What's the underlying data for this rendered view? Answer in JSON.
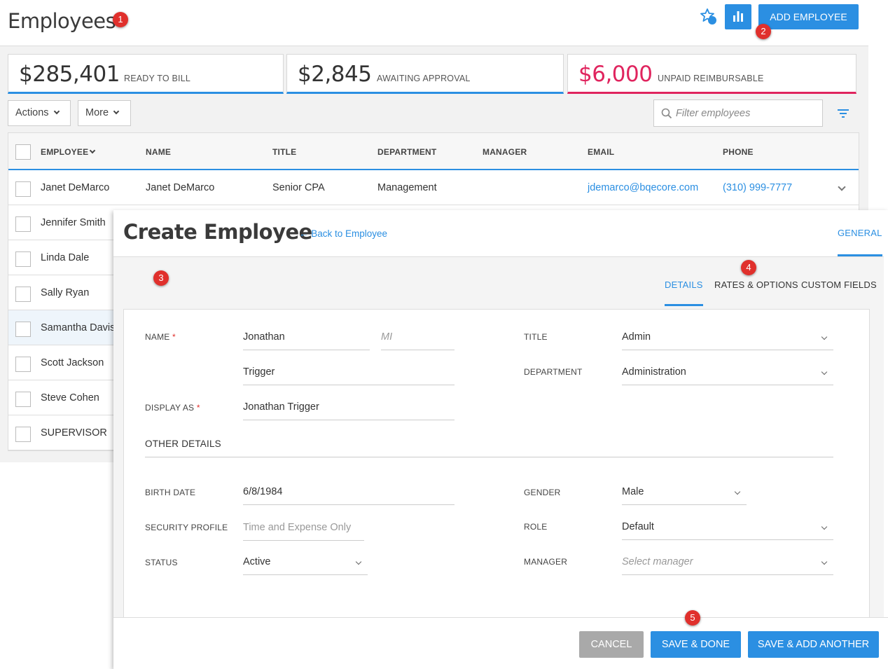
{
  "page": {
    "title": "Employees",
    "add_button": "ADD EMPLOYEE",
    "star_icon": "favorite-star-icon",
    "chart_icon": "bar-chart-icon"
  },
  "annotations": [
    "1",
    "2",
    "3",
    "4",
    "5"
  ],
  "kpis": [
    {
      "value": "$285,401",
      "label": "READY TO BILL",
      "color": "#2b8fe2"
    },
    {
      "value": "$2,845",
      "label": "AWAITING APPROVAL",
      "color": "#2b8fe2"
    },
    {
      "value": "$6,000",
      "label": "UNPAID REIMBURSABLE",
      "color": "#e0245e"
    }
  ],
  "toolbar": {
    "actions": "Actions",
    "more": "More",
    "filter_placeholder": "Filter employees"
  },
  "grid": {
    "columns": [
      "EMPLOYEE",
      "NAME",
      "TITLE",
      "DEPARTMENT",
      "MANAGER",
      "EMAIL",
      "PHONE"
    ],
    "rows": [
      {
        "employee": "Janet DeMarco",
        "name": "Janet DeMarco",
        "title": "Senior CPA",
        "department": "Management",
        "manager": "",
        "email": "jdemarco@bqecore.com",
        "phone": "(310) 999-7777"
      },
      {
        "employee": "Jennifer Smith"
      },
      {
        "employee": "Linda Dale"
      },
      {
        "employee": "Sally Ryan"
      },
      {
        "employee": "Samantha Davis"
      },
      {
        "employee": "Scott Jackson"
      },
      {
        "employee": "Steve Cohen"
      },
      {
        "employee": "SUPERVISOR"
      }
    ]
  },
  "modal": {
    "title": "Create Employee",
    "back_link": "← Back to Employee",
    "main_tab": "GENERAL",
    "tabs": [
      "DETAILS",
      "RATES & OPTIONS",
      "CUSTOM FIELDS"
    ],
    "form": {
      "name_label": "NAME",
      "first_name": "Jonathan",
      "mi_placeholder": "MI",
      "last_name": "Trigger",
      "display_as_label": "DISPLAY AS",
      "display_as": "Jonathan Trigger",
      "title_label": "TITLE",
      "title_value": "Admin",
      "department_label": "DEPARTMENT",
      "department_value": "Administration",
      "other_details": "OTHER DETAILS",
      "birth_date_label": "BIRTH DATE",
      "birth_date": "6/8/1984",
      "security_profile_label": "SECURITY PROFILE",
      "security_profile_placeholder": "Time and Expense Only",
      "status_label": "STATUS",
      "status_value": "Active",
      "gender_label": "GENDER",
      "gender_value": "Male",
      "role_label": "ROLE",
      "role_value": "Default",
      "manager_label": "MANAGER",
      "manager_placeholder": "Select manager",
      "required_mark": "*"
    },
    "footer": {
      "cancel": "CANCEL",
      "save_done": "SAVE & DONE",
      "save_add": "SAVE & ADD ANOTHER"
    }
  },
  "colors": {
    "accent": "#2b8fe2",
    "danger": "#e0245e",
    "badge": "#e0302c"
  }
}
